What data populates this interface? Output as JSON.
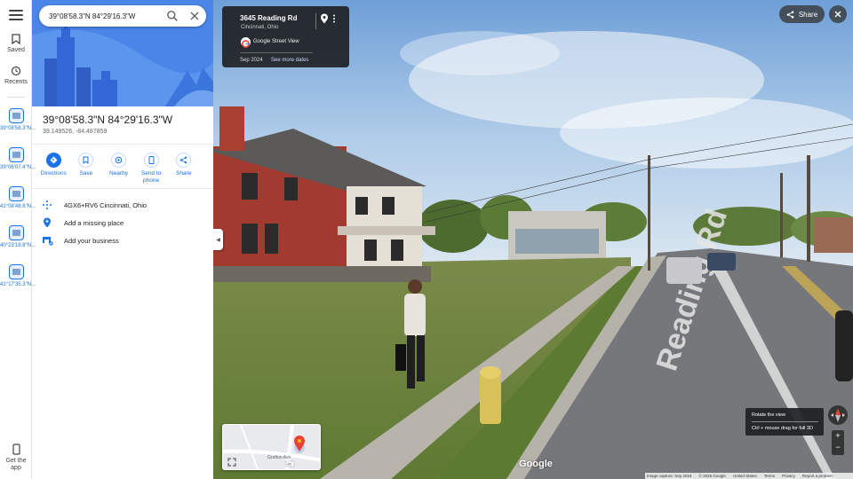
{
  "rail": {
    "saved_label": "Saved",
    "recents_label": "Recents",
    "get_app_label": "Get the app",
    "recent_items": [
      {
        "label": "39°08'58.3\"N..."
      },
      {
        "label": "39°06'07.4\"N..."
      },
      {
        "label": "41°08'48.6\"N..."
      },
      {
        "label": "40°23'19.8\"N..."
      },
      {
        "label": "41°17'35.3\"N..."
      }
    ]
  },
  "search": {
    "value": "39°08'58.3\"N 84°29'16.3\"W"
  },
  "place": {
    "title": "39°08'58.3\"N 84°29'16.3\"W",
    "coords": "39.149526, -84.487859"
  },
  "actions": {
    "directions": "Directions",
    "save": "Save",
    "nearby": "Nearby",
    "send_to_phone": "Send to phone",
    "share": "Share"
  },
  "info": {
    "plus_code": "4GX6+RV6 Cincinnati, Ohio",
    "add_place": "Add a missing place",
    "add_business": "Add your business"
  },
  "streetview": {
    "address": "3645 Reading Rd",
    "city": "Cincinnati, Ohio",
    "source": "Google Street View",
    "date": "Sep 2024",
    "more_dates": "See more dates",
    "share_label": "Share",
    "road_text": "Reading Rd",
    "tooltip_title": "Rotate the view",
    "tooltip_hint": "Ctrl + mouse drag for full 3D",
    "watermark": "Google",
    "map_street": "Grafton Ave",
    "map_route": "42"
  },
  "footer": {
    "capture": "Image capture: Sep 2024",
    "copyright": "© 2025 Google",
    "country": "United States",
    "terms": "Terms",
    "privacy": "Privacy",
    "report": "Report a problem"
  },
  "colors": {
    "accent": "#1a73e8",
    "hero_bg": "#4a86e8"
  }
}
